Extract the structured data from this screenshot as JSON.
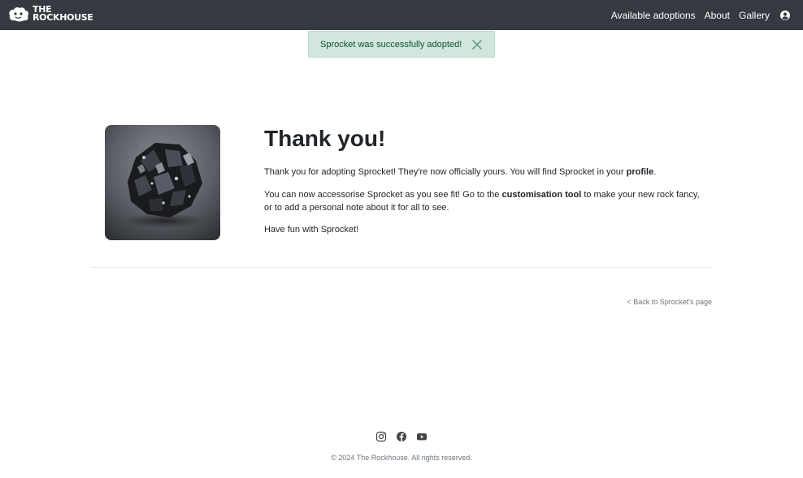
{
  "brand": {
    "line1": "THE",
    "line2": "ROCKHOUSE"
  },
  "nav": {
    "items": [
      {
        "label": "Available adoptions"
      },
      {
        "label": "About"
      },
      {
        "label": "Gallery"
      }
    ],
    "user_icon": "user-circle-icon"
  },
  "alert": {
    "message": "Sprocket was successfully adopted!",
    "close_icon": "close-icon",
    "colors": {
      "background": "#d1e7dd",
      "text": "#0f5132"
    }
  },
  "main": {
    "heading": "Thank you!",
    "p1_before": "Thank you for adopting Sprocket! They're now officially yours. You will find Sprocket in your ",
    "p1_link": "profile",
    "p1_after": ".",
    "p2_before": "You can now accessorise Sprocket as you see fit! Go to the ",
    "p2_link": "customisation tool",
    "p2_after": " to make your new rock fancy, or to add a personal note about it for all to see.",
    "p3": "Have fun with Sprocket!",
    "back_link": "< Back to Sprocket's page"
  },
  "footer": {
    "social_icons": [
      "instagram-icon",
      "facebook-icon",
      "youtube-icon"
    ],
    "copyright": "© 2024 The Rockhouse. All rights reserved."
  },
  "colors": {
    "navbar": "#343a40",
    "muted_text": "#6c757d"
  }
}
